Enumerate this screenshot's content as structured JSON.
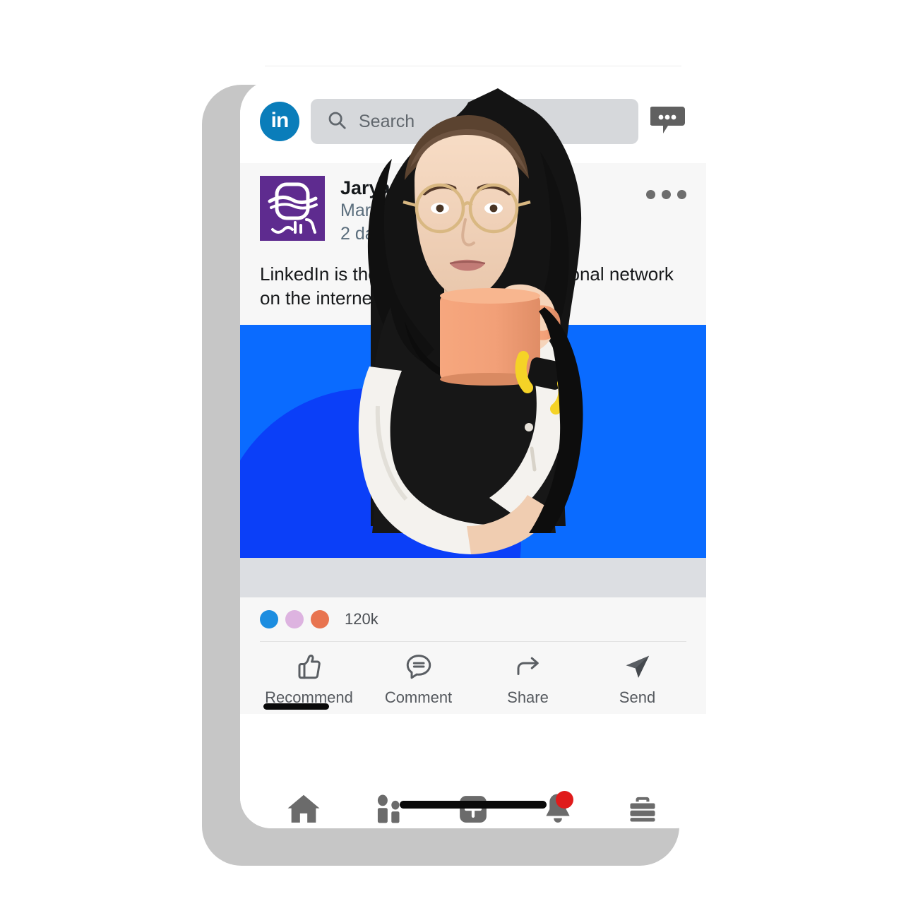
{
  "app": {
    "name": "LinkedIn",
    "logo_text": "in",
    "brand_color": "#0a7dba"
  },
  "header": {
    "logo_icon": "linkedin-logo-icon",
    "search": {
      "placeholder": "Search",
      "value": "",
      "icon": "search-icon"
    },
    "messaging_icon": "messaging-bubble-icon"
  },
  "post": {
    "author": "Jaryan",
    "subtitle": "Marketing",
    "time": "2 days",
    "separator": "·",
    "visibility_icon": "globe-icon",
    "options_icon": "more-options-icon",
    "body": "LinkedIn is the world's largest professional network on the internet to find the right job.",
    "avatar": {
      "icon": "jaryan-logo-icon",
      "background": "#5e2b8f",
      "wordmark": "جریان"
    },
    "media": {
      "background_color": "#0a6bff",
      "circle_color": "#0b3ff8",
      "caption_bar_color": "#dcdee2",
      "photo_alt": "woman-holding-mug-photo"
    },
    "reactions": {
      "count": "120k",
      "dots": [
        {
          "name": "like-reaction-dot",
          "color": "#1c8de0"
        },
        {
          "name": "love-reaction-dot",
          "color": "#ddb3e0"
        },
        {
          "name": "celebrate-reaction-dot",
          "color": "#e87450"
        }
      ]
    },
    "actions": [
      {
        "label": "Recommend",
        "icon": "thumbs-up-icon"
      },
      {
        "label": "Comment",
        "icon": "comment-bubble-icon"
      },
      {
        "label": "Share",
        "icon": "share-arrow-icon"
      },
      {
        "label": "Send",
        "icon": "send-paper-plane-icon"
      }
    ]
  },
  "bottom_nav": [
    {
      "name": "home",
      "icon": "home-icon",
      "badge": ""
    },
    {
      "name": "my-network",
      "icon": "people-icon",
      "badge": ""
    },
    {
      "name": "post",
      "icon": "plus-square-icon",
      "badge": ""
    },
    {
      "name": "notifications",
      "icon": "bell-icon",
      "badge": "dot"
    },
    {
      "name": "jobs",
      "icon": "briefcase-icon",
      "badge": ""
    }
  ]
}
